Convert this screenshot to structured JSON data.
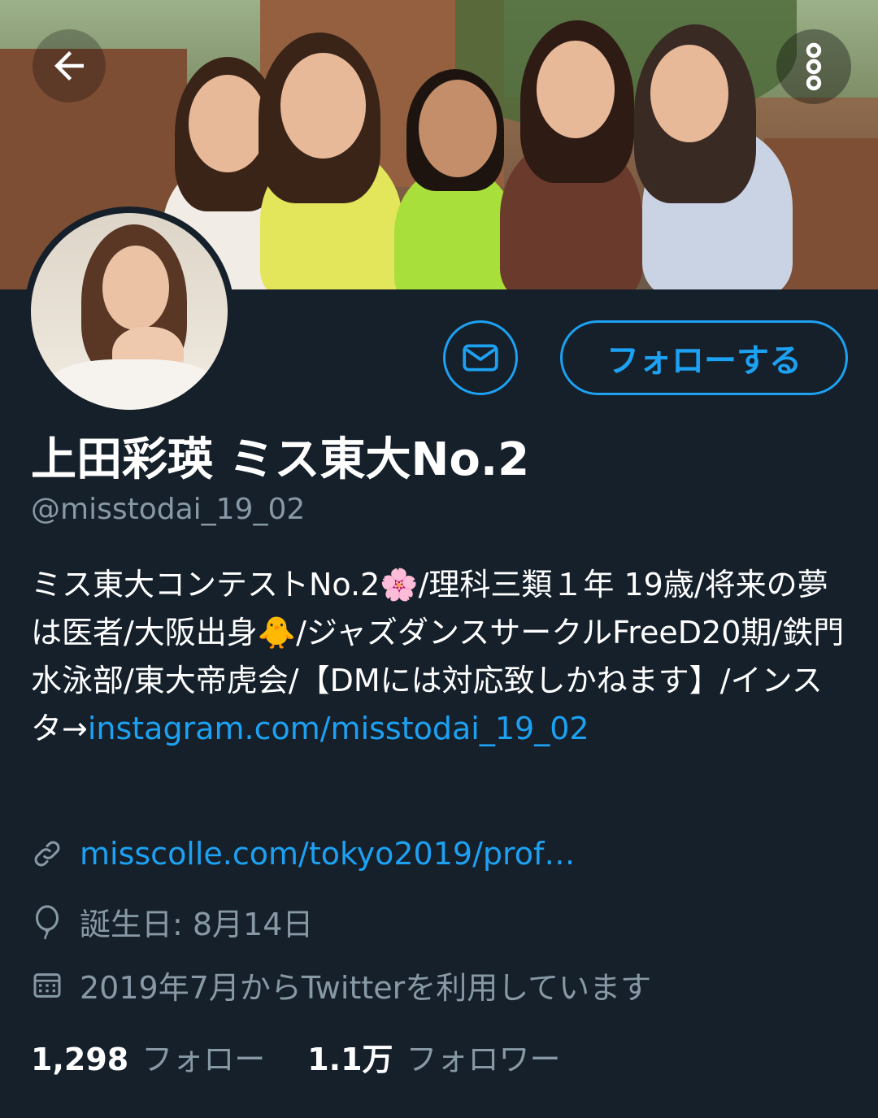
{
  "header": {
    "back_icon": "arrow-left-icon",
    "more_icon": "more-vertical-icon"
  },
  "actions": {
    "dm_icon": "envelope-icon",
    "follow_label": "フォローする"
  },
  "profile": {
    "display_name": "上田彩瑛 ミス東大No.2",
    "handle": "@misstodai_19_02",
    "bio_parts": {
      "p1": "ミス東大コンテストNo.2",
      "emoji1": "🌸",
      "p2": "/理科三類１年 19歳/将来の夢は医者/大阪出身",
      "emoji2": "🐥",
      "p3": "/ジャズダンスサークルFreeD20期/鉄門水泳部/東大帝虎会/【DMには対応致しかねます】/インスタ→",
      "link": "instagram.com/misstodai_19_02"
    },
    "website": "misscolle.com/tokyo2019/prof…",
    "birthday": "誕生日: 8月14日",
    "joined": "2019年7月からTwitterを利用しています"
  },
  "stats": {
    "following_count": "1,298",
    "following_label": "フォロー",
    "followers_count": "1.1万",
    "followers_label": "フォロワー"
  },
  "colors": {
    "background": "#15202b",
    "accent": "#1da1f2",
    "secondary_text": "#8899a6",
    "primary_text": "#ffffff"
  }
}
